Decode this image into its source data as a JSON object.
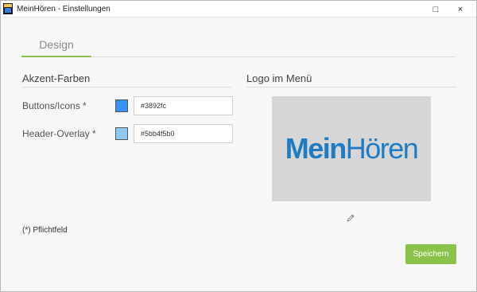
{
  "window": {
    "title": "MeinHören - Einstellungen",
    "maximize_glyph": "□",
    "close_glyph": "×"
  },
  "tabs": [
    {
      "label": "Design",
      "active": true
    }
  ],
  "accent_colors": {
    "title": "Akzent-Farben",
    "fields": [
      {
        "label": "Buttons/Icons *",
        "value": "#3892fc",
        "swatch_color": "#3892fc"
      },
      {
        "label": "Header-Overlay *",
        "value": "#5bb4f5b0",
        "swatch_color": "#5bb4f5b0"
      }
    ]
  },
  "logo_section": {
    "title": "Logo im Menü",
    "logo_bold": "Mein",
    "logo_regular": "Hören",
    "logo_color": "#1e7cc4",
    "logo_background": "#d6d6d6",
    "edit_icon": "pencil-icon"
  },
  "required_note": "(*) Pflichtfeld",
  "save_button": {
    "label": "Speichern",
    "color": "#8bc34a"
  },
  "theme": {
    "tab_underline": "#8bc34a",
    "window_bg": "#f7f7f7"
  }
}
